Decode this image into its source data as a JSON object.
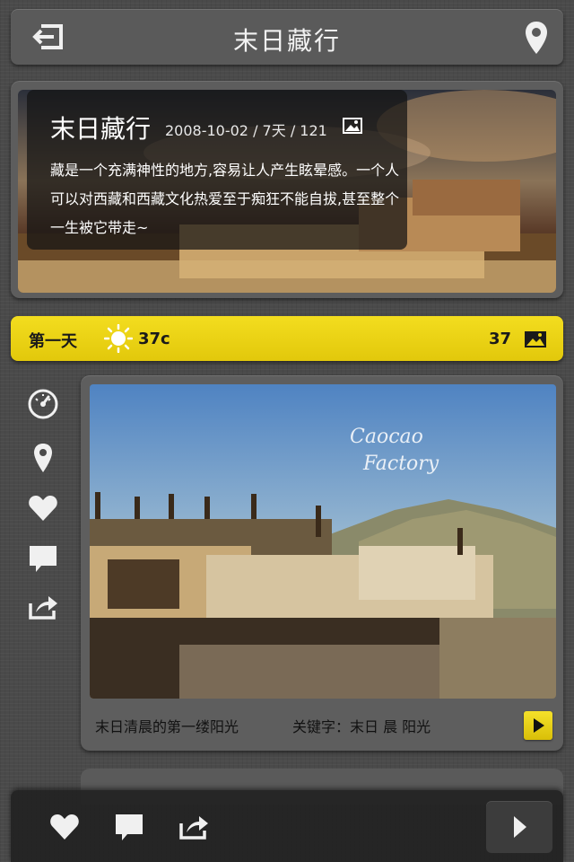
{
  "header": {
    "title": "末日藏行",
    "back_icon": "exit-icon",
    "location_icon": "map-pin-icon"
  },
  "hero": {
    "title": "末日藏行",
    "meta": "2008-10-02 / 7天 / 121",
    "description": "藏是一个充满神性的地方,容易让人产生眩晕感。一个人可以对西藏和西藏文化热爱至于痴狂不能自拔,甚至整个一生被它带走~"
  },
  "day": {
    "label": "第一天",
    "temperature": "37c",
    "photo_count": "37",
    "accent_color": "#ecd313"
  },
  "post": {
    "caption": "末日清晨的第一缕阳光",
    "keywords": "关键字：末日 晨 阳光",
    "watermark_line1": "Caocao",
    "watermark_line2": "Factory"
  },
  "icons": {
    "side": [
      "speedometer-icon",
      "map-pin-icon",
      "heart-icon",
      "comment-icon",
      "share-icon"
    ],
    "bottom": [
      "heart-icon",
      "comment-icon",
      "share-icon",
      "next-arrow-icon"
    ]
  }
}
